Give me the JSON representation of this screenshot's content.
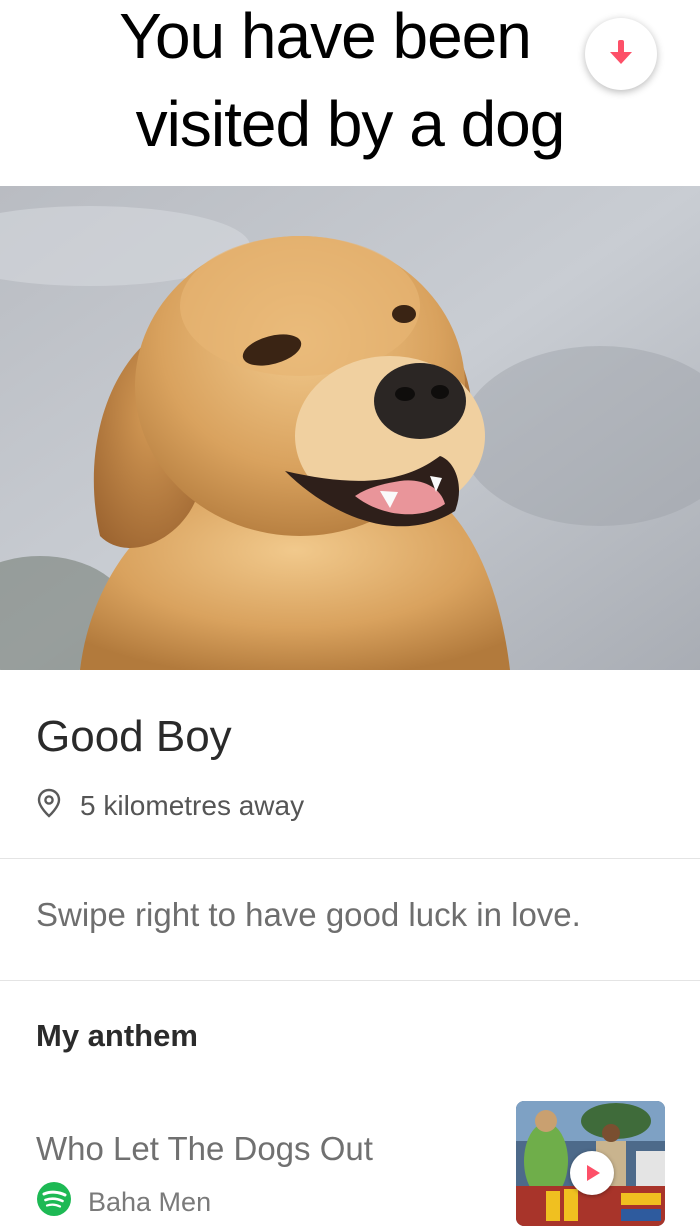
{
  "caption": {
    "line1": "You have been",
    "line2": "visited by a dog"
  },
  "profile": {
    "name": "Good Boy",
    "distance": "5 kilometres away",
    "bio": "Swipe right to have good luck in love."
  },
  "anthem": {
    "heading": "My anthem",
    "song_title": "Who Let The Dogs Out",
    "artist": "Baha Men"
  },
  "icons": {
    "collapse": "arrow-down-icon",
    "location": "location-pin-icon",
    "spotify": "spotify-icon",
    "play": "play-icon"
  },
  "colors": {
    "accent": "#fd5068",
    "spotify": "#1db954",
    "dog_fur": "#d9a25e"
  }
}
